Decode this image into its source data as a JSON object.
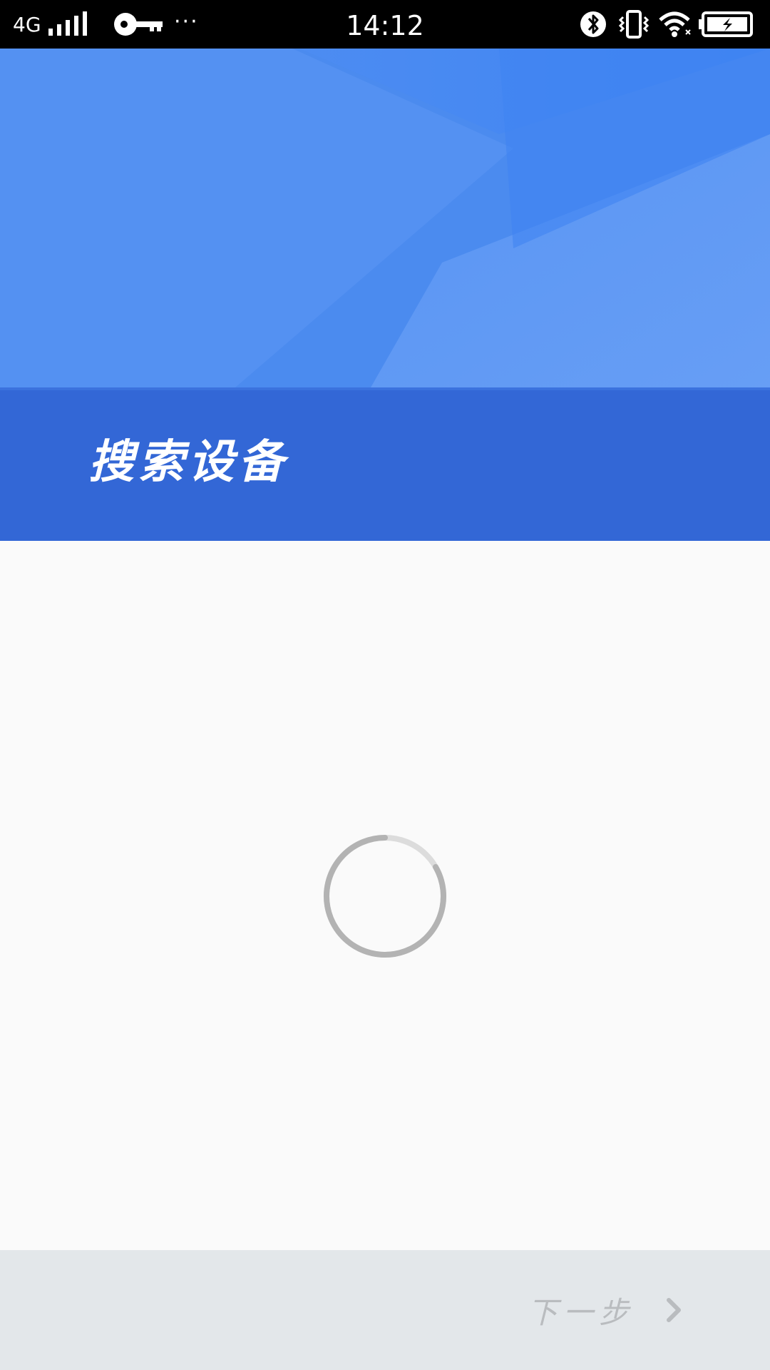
{
  "status_bar": {
    "network": "4G",
    "time": "14:12",
    "more": "···",
    "icons": [
      "signal-icon",
      "vpn-key-icon",
      "bluetooth-icon",
      "vibrate-icon",
      "wifi-icon",
      "battery-charging-icon"
    ]
  },
  "header": {
    "title": "搜索设备"
  },
  "content": {
    "loading_icon": "spinner-icon"
  },
  "footer": {
    "next_label": "下一步",
    "next_icon": "chevron-right-icon"
  },
  "colors": {
    "banner_top": "#4688ee",
    "banner_bottom": "#3366d6",
    "background": "#fafafa",
    "bottom_bar": "#e3e7ea",
    "disabled_text": "#b9bcbf"
  }
}
